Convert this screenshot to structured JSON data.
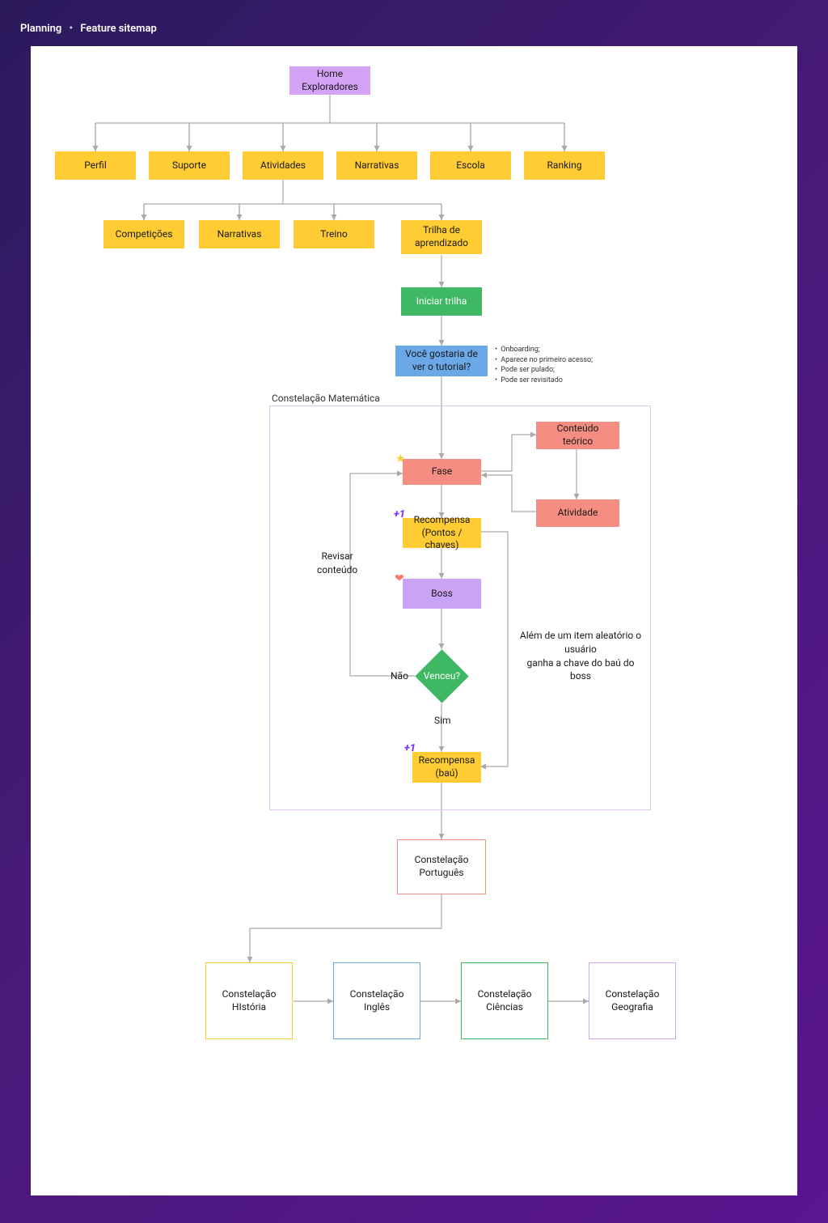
{
  "header": {
    "section": "Planning",
    "page": "Feature sitemap"
  },
  "nodes": {
    "home": "Home\nExploradores",
    "perfil": "Perfil",
    "suporte": "Suporte",
    "atividades": "Atividades",
    "narrativas": "Narrativas",
    "escola": "Escola",
    "ranking": "Ranking",
    "competicoes": "Competições",
    "narrativas2": "Narrativas",
    "treino": "Treino",
    "trilha": "Trilha de\naprendizado",
    "iniciar": "Iniciar trilha",
    "tutorial": "Você gostaria de\nver o tutorial?",
    "frameTitle": "Constelação Matemática",
    "fase": "Fase",
    "conteudo": "Conteúdo teórico",
    "atividade": "Atividade",
    "recompensa1": "Recompensa\n(Pontos / chaves)",
    "boss": "Boss",
    "venceu": "Venceu?",
    "recompensa2": "Recompensa\n(baú)",
    "portugues": "Constelação\nPortuguês",
    "historia": "Constelação\nHIstória",
    "ingles": "Constelação\nInglês",
    "ciencias": "Constelação\nCiências",
    "geografia": "Constelação\nGeografia"
  },
  "labels": {
    "revisar": "Revisar\nconteúdo",
    "nao": "Não",
    "sim": "Sim",
    "alem": "Além de um item aleatório o usuário\nganha a chave do baú do boss"
  },
  "bullets": [
    "Onboarding;",
    "Aparece no primeiro acesso;",
    "Pode ser pulado;",
    "Pode ser revisitado"
  ],
  "icons": {
    "star": "★",
    "heart": "❤"
  }
}
